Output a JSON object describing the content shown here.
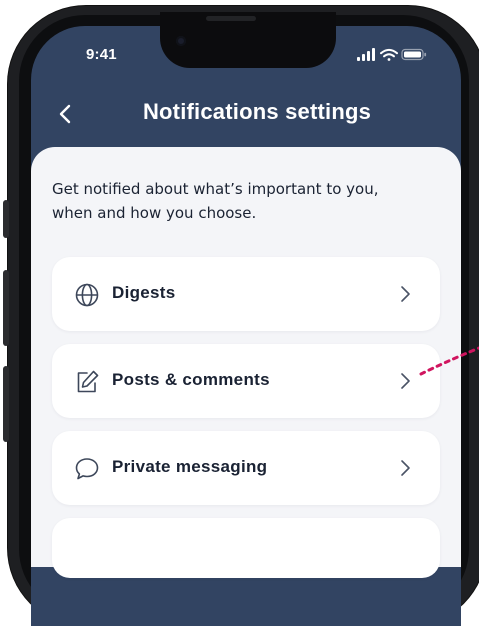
{
  "status_bar": {
    "time": "9:41"
  },
  "header": {
    "title": "Notifications settings"
  },
  "intro": {
    "text": "Get notified about what’s important to you, when and how you choose."
  },
  "settings": {
    "items": [
      {
        "label": "Digests",
        "icon": "globe-icon"
      },
      {
        "label": "Posts & comments",
        "icon": "edit-icon"
      },
      {
        "label": "Private messaging",
        "icon": "chat-bubble-icon"
      }
    ]
  },
  "colors": {
    "header_bg": "#324462",
    "content_bg": "#f4f5f8",
    "card_bg": "#ffffff",
    "text_primary": "#1a2233",
    "accent_connector": "#d0155f"
  }
}
